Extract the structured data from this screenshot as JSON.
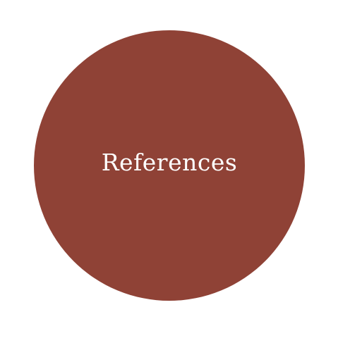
{
  "button": {
    "label": "References",
    "fill_color": "#8f4236",
    "text_color": "#ffffff"
  },
  "background_color": "#ffffff"
}
